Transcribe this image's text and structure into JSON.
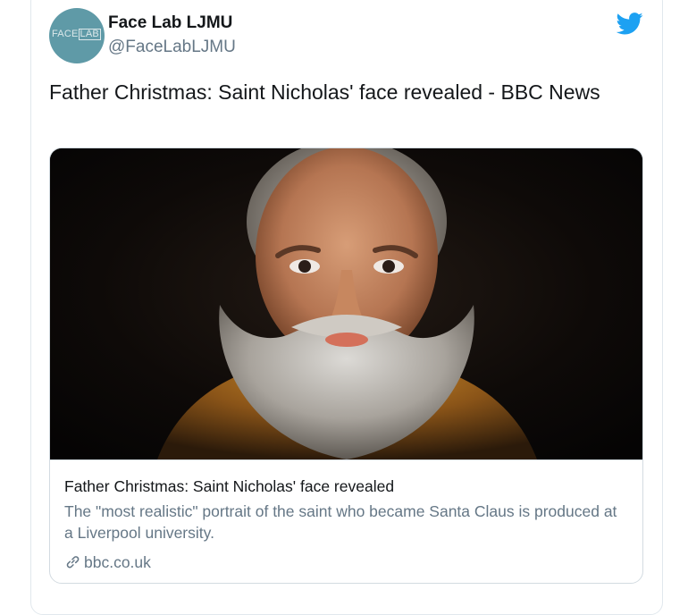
{
  "tweet": {
    "author": {
      "name": "Face Lab LJMU",
      "handle": "@FaceLabLJMU",
      "avatar_text_plain": "FACE",
      "avatar_text_boxed": "LAB"
    },
    "icons": {
      "brand": "twitter-bird-icon",
      "link": "link-icon"
    },
    "text": "Father Christmas: Saint Nicholas' face revealed - BBC News",
    "card": {
      "image_subject": "Saint Nicholas facial reconstruction portrait",
      "title": "Father Christmas: Saint Nicholas' face revealed",
      "description": "The \"most realistic\" portrait of the saint who became Santa Claus is produced at a Liverpool university.",
      "domain": "bbc.co.uk"
    }
  },
  "colors": {
    "twitter_blue": "#1da1f2",
    "text_primary": "#14171a",
    "text_secondary": "#657786",
    "border": "#e1e8ed",
    "avatar_bg": "#5f9aa7"
  }
}
